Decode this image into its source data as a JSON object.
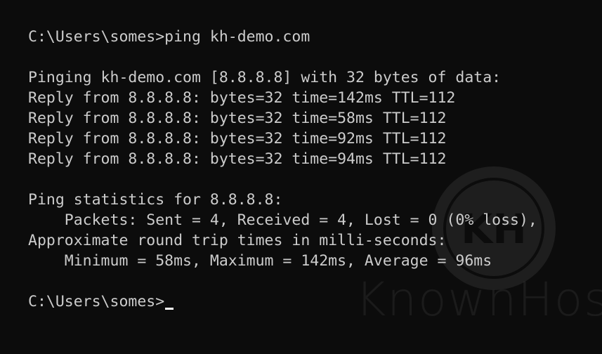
{
  "terminal": {
    "lines": [
      "C:\\Users\\somes>ping kh-demo.com",
      "",
      "Pinging kh-demo.com [8.8.8.8] with 32 bytes of data:",
      "Reply from 8.8.8.8: bytes=32 time=142ms TTL=112",
      "Reply from 8.8.8.8: bytes=32 time=58ms TTL=112",
      "Reply from 8.8.8.8: bytes=32 time=92ms TTL=112",
      "Reply from 8.8.8.8: bytes=32 time=94ms TTL=112",
      "",
      "Ping statistics for 8.8.8.8:",
      "    Packets: Sent = 4, Received = 4, Lost = 0 (0% loss),",
      "Approximate round trip times in milli-seconds:",
      "    Minimum = 58ms, Maximum = 142ms, Average = 96ms",
      "",
      "C:\\Users\\somes>"
    ]
  },
  "watermark": {
    "logo_text": "KH",
    "text": "KnownHost"
  },
  "colors": {
    "background": "#0c0c0c",
    "text": "#cccccc",
    "cursor": "#ffffff"
  }
}
